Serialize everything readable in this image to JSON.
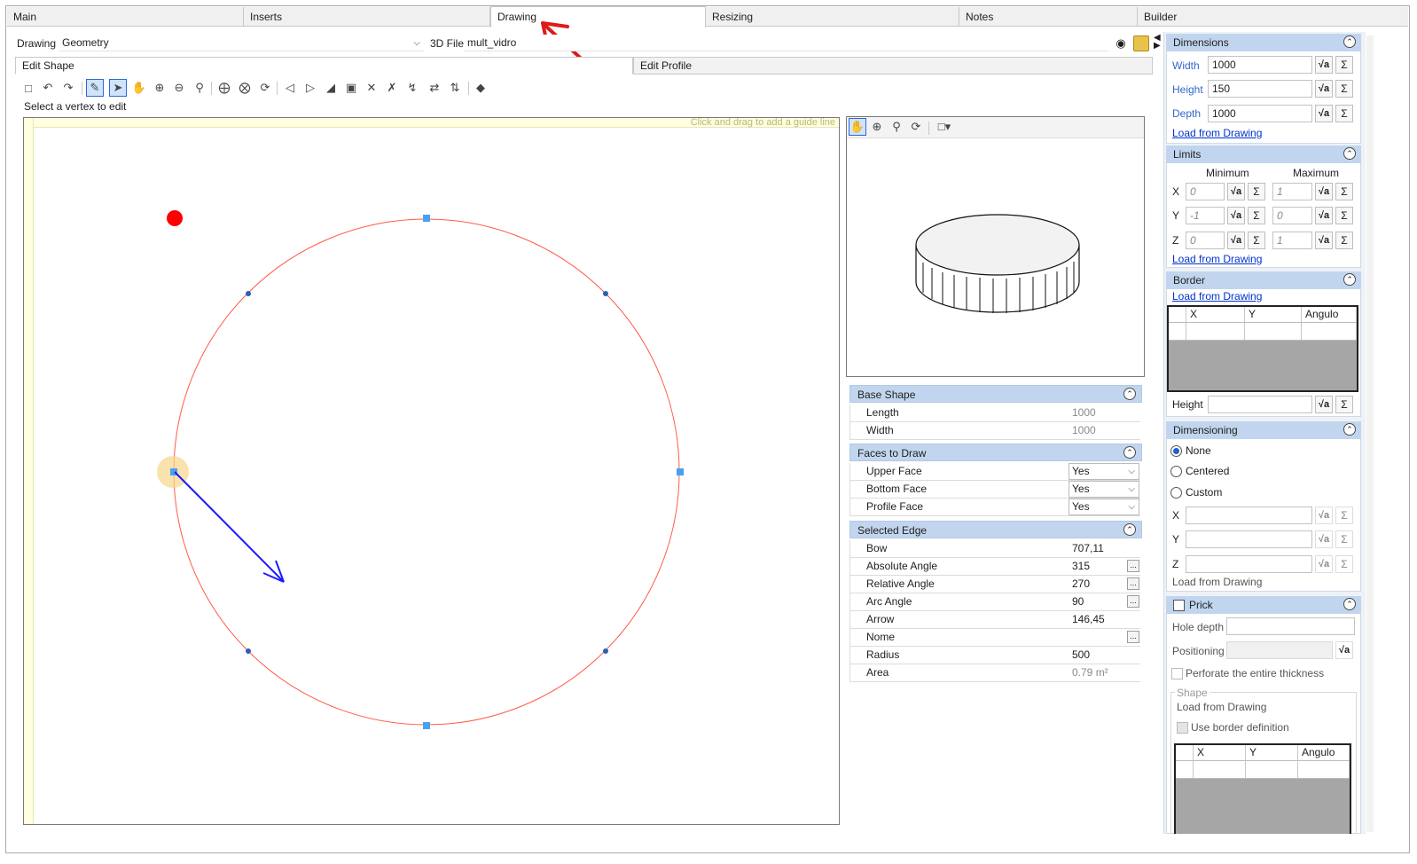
{
  "tabs": [
    "Main",
    "Inserts",
    "Drawing",
    "Resizing",
    "Notes",
    "Builder"
  ],
  "top": {
    "drawing_label": "Drawing",
    "drawing_value": "Geometry",
    "file_label": "3D File",
    "file_value": "mult_vidro"
  },
  "subtabs": [
    "Edit Shape",
    "Edit Profile"
  ],
  "status_hint": "Select a vertex to edit",
  "guide_hint": "Click and drag to add a guide line",
  "base_shape": {
    "title": "Base Shape",
    "rows": [
      {
        "k": "Length",
        "v": "1000"
      },
      {
        "k": "Width",
        "v": "1000"
      }
    ]
  },
  "faces": {
    "title": "Faces to Draw",
    "rows": [
      {
        "k": "Upper Face",
        "v": "Yes"
      },
      {
        "k": "Bottom Face",
        "v": "Yes"
      },
      {
        "k": "Profile Face",
        "v": "Yes"
      }
    ]
  },
  "edge": {
    "title": "Selected Edge",
    "rows": [
      {
        "k": "Bow",
        "v": "707,11",
        "ell": false
      },
      {
        "k": "Absolute Angle",
        "v": "315",
        "ell": true
      },
      {
        "k": "Relative Angle",
        "v": "270",
        "ell": true
      },
      {
        "k": "Arc Angle",
        "v": "90",
        "ell": true
      },
      {
        "k": "Arrow",
        "v": "146,45",
        "ell": false
      },
      {
        "k": "Nome",
        "v": "",
        "ell": true
      },
      {
        "k": "Radius",
        "v": "500",
        "ell": false
      },
      {
        "k": "Area",
        "v": "0.79 m²",
        "ell": false
      }
    ]
  },
  "dimensions": {
    "title": "Dimensions",
    "width_label": "Width",
    "width": "1000",
    "height_label": "Height",
    "height": "150",
    "depth_label": "Depth",
    "depth": "1000",
    "load": "Load from Drawing"
  },
  "limits": {
    "title": "Limits",
    "min_label": "Minimum",
    "max_label": "Maximum",
    "x_label": "X",
    "y_label": "Y",
    "z_label": "Z",
    "x_min": "0",
    "x_max": "1",
    "y_min": "-1",
    "y_max": "0",
    "z_min": "0",
    "z_max": "1",
    "load": "Load from Drawing"
  },
  "border": {
    "title": "Border",
    "load": "Load from Drawing",
    "cols": [
      "X",
      "Y",
      "Angulo"
    ],
    "height_label": "Height"
  },
  "dimensioning": {
    "title": "Dimensioning",
    "options": [
      "None",
      "Centered",
      "Custom"
    ],
    "x_label": "X",
    "y_label": "Y",
    "z_label": "Z",
    "load": "Load from Drawing"
  },
  "prick": {
    "title": "Prick",
    "hole_depth": "Hole depth",
    "positioning": "Positioning",
    "perforate": "Perforate the entire thickness",
    "shape_label": "Shape",
    "load": "Load from Drawing",
    "use_border": "Use border definition",
    "cols": [
      "X",
      "Y",
      "Angulo"
    ]
  },
  "icons": {
    "sqrt": "√a",
    "sigma": "Σ",
    "ellipsis": "...",
    "collapse": "⌃"
  },
  "colors": {
    "panel_header": "#c1d6ee",
    "circle": "#ff5a4a",
    "arrow": "#1a1aff",
    "vertex": "#4aa0f0",
    "point": "#ff0000",
    "annotation": "#e01a1a"
  }
}
